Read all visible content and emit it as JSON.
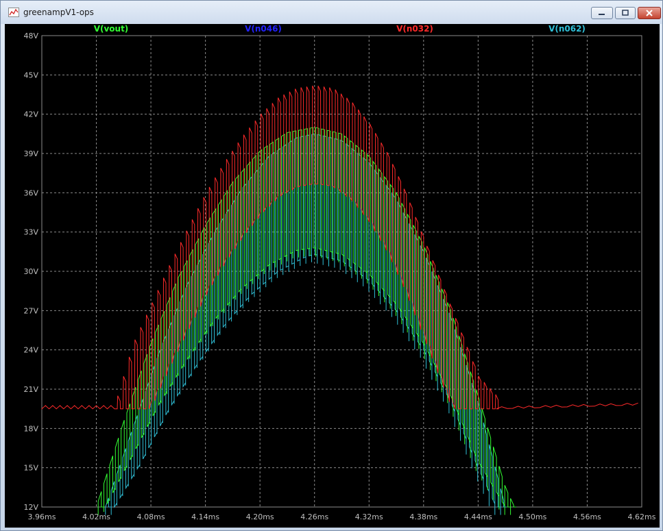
{
  "window": {
    "title": "greenampV1-ops"
  },
  "colors": {
    "vout": "#33ff33",
    "n046": "#2222ff",
    "n032": "#ff2a2a",
    "n062": "#30c0d8",
    "axis_text": "#c0c0c0",
    "grid": "#8c8c8c"
  },
  "chart_data": {
    "type": "line",
    "xlabel": "",
    "ylabel": "",
    "xlim": [
      3.96,
      4.62
    ],
    "ylim": [
      12,
      48
    ],
    "xticks": [
      "3.96ms",
      "4.02ms",
      "4.08ms",
      "4.14ms",
      "4.20ms",
      "4.26ms",
      "4.32ms",
      "4.38ms",
      "4.44ms",
      "4.50ms",
      "4.56ms",
      "4.62ms"
    ],
    "yticks": [
      "12V",
      "15V",
      "18V",
      "21V",
      "24V",
      "27V",
      "30V",
      "33V",
      "36V",
      "39V",
      "42V",
      "45V",
      "48V"
    ],
    "grid": true,
    "legend_position": "top",
    "series": [
      {
        "name": "V(vout)",
        "description": "chopped waveform with a sinusoidal envelope; upper peak tips and a lower switching level",
        "upper_envelope": {
          "x": [
            4.02,
            4.05,
            4.08,
            4.11,
            4.14,
            4.17,
            4.2,
            4.23,
            4.26,
            4.29,
            4.32,
            4.35,
            4.38,
            4.41,
            4.44,
            4.47,
            4.48
          ],
          "y": [
            12.0,
            18.5,
            24.5,
            29.5,
            33.5,
            36.8,
            39.2,
            40.6,
            41.0,
            40.5,
            38.8,
            36.0,
            32.0,
            27.0,
            20.5,
            13.5,
            12.0
          ]
        },
        "lower_envelope": {
          "x": [
            4.03,
            4.06,
            4.09,
            4.12,
            4.15,
            4.18,
            4.21,
            4.24,
            4.26,
            4.29,
            4.32,
            4.35,
            4.38,
            4.41,
            4.44,
            4.47
          ],
          "y": [
            12.0,
            16.0,
            20.0,
            23.3,
            26.3,
            28.7,
            30.5,
            31.6,
            31.8,
            31.3,
            29.8,
            27.5,
            24.5,
            20.5,
            15.5,
            12.0
          ]
        }
      },
      {
        "name": "V(n046)",
        "description": "legend entry; trace hidden behind the other traces"
      },
      {
        "name": "V(n032)",
        "baseline_v": 19.5,
        "baseline_right_v": 19.8,
        "upper_envelope": {
          "x": [
            4.043,
            4.06,
            4.08,
            4.1,
            4.12,
            4.14,
            4.16,
            4.18,
            4.2,
            4.22,
            4.24,
            4.26,
            4.28,
            4.3,
            4.32,
            4.34,
            4.36,
            4.38,
            4.4,
            4.42,
            4.44,
            4.46
          ],
          "y": [
            20.5,
            24.5,
            27.5,
            30.5,
            33.3,
            36.0,
            38.3,
            40.3,
            42.0,
            43.3,
            44.0,
            44.2,
            44.0,
            43.0,
            41.3,
            39.0,
            36.0,
            32.5,
            29.0,
            25.5,
            22.0,
            20.5
          ]
        }
      },
      {
        "name": "V(n062)",
        "description": "chopped waveform slightly below V(vout)",
        "upper_envelope": {
          "x": [
            4.03,
            4.06,
            4.09,
            4.12,
            4.15,
            4.18,
            4.21,
            4.24,
            4.26,
            4.29,
            4.32,
            4.35,
            4.38,
            4.41,
            4.44,
            4.47
          ],
          "y": [
            12.0,
            18.0,
            24.0,
            29.0,
            33.0,
            36.3,
            38.8,
            40.2,
            40.5,
            40.0,
            38.3,
            35.5,
            31.5,
            26.5,
            20.0,
            12.0
          ]
        },
        "lower_envelope": {
          "x": [
            4.04,
            4.07,
            4.1,
            4.13,
            4.16,
            4.19,
            4.22,
            4.25,
            4.26,
            4.29,
            4.32,
            4.35,
            4.38,
            4.41,
            4.44,
            4.46
          ],
          "y": [
            12.0,
            15.5,
            19.5,
            22.8,
            25.8,
            28.2,
            30.0,
            31.1,
            31.3,
            30.8,
            29.3,
            27.0,
            24.0,
            20.0,
            15.0,
            12.0
          ]
        }
      }
    ]
  }
}
